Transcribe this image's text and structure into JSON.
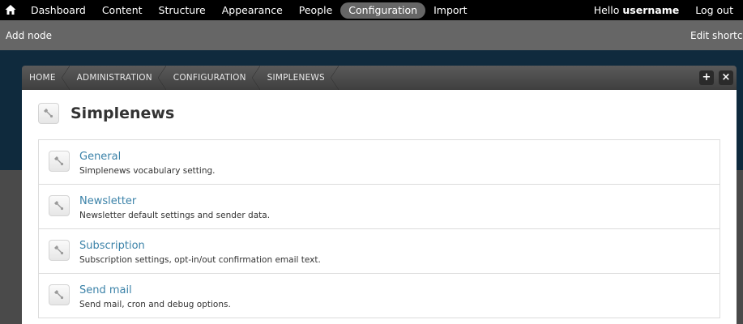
{
  "toolbar": {
    "home_icon": "home-icon",
    "menu": [
      {
        "label": "Dashboard"
      },
      {
        "label": "Content"
      },
      {
        "label": "Structure"
      },
      {
        "label": "Appearance"
      },
      {
        "label": "People"
      },
      {
        "label": "Configuration",
        "active": true
      },
      {
        "label": "Import"
      }
    ],
    "hello_prefix": "Hello",
    "username": "username",
    "logout": "Log out"
  },
  "shortcuts": {
    "add_node": "Add node",
    "edit_shortcuts": "Edit shortcu"
  },
  "overlay": {
    "breadcrumb": [
      "HOME",
      "ADMINISTRATION",
      "CONFIGURATION",
      "SIMPLENEWS"
    ],
    "buttons": {
      "add": "+",
      "close": "×"
    },
    "page_title": "Simplenews",
    "items": [
      {
        "title": "General",
        "description": "Simplenews vocabulary setting."
      },
      {
        "title": "Newsletter",
        "description": "Newsletter default settings and sender data."
      },
      {
        "title": "Subscription",
        "description": "Subscription settings, opt-in/out confirmation email text."
      },
      {
        "title": "Send mail",
        "description": "Send mail, cron and debug options."
      }
    ]
  },
  "colors": {
    "toolbar_bg": "#000000",
    "shortcut_bg": "#666666",
    "active_pill": "#666666",
    "link": "#3b82a8"
  }
}
